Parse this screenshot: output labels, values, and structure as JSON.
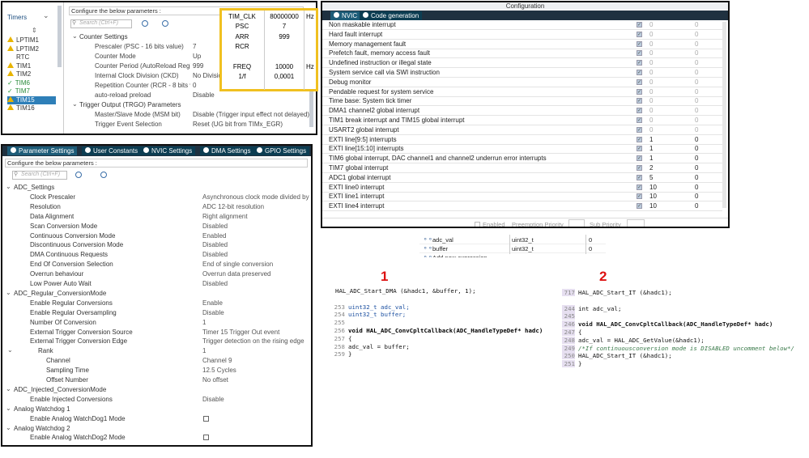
{
  "timers": {
    "header": "Timers",
    "items": [
      {
        "label": "LPTIM1",
        "status": "warn"
      },
      {
        "label": "LPTIM2",
        "status": "warn"
      },
      {
        "label": "RTC",
        "status": "none"
      },
      {
        "label": "TIM1",
        "status": "warn"
      },
      {
        "label": "TIM2",
        "status": "warn"
      },
      {
        "label": "TIM6",
        "status": "ok"
      },
      {
        "label": "TIM7",
        "status": "ok"
      },
      {
        "label": "TIM15",
        "status": "selected"
      },
      {
        "label": "TIM16",
        "status": "warn"
      }
    ]
  },
  "tim_params": {
    "configure_label": "Configure the below parameters :",
    "search_placeholder": "Search (Ctrl+F)",
    "rows": [
      {
        "label": "Counter Settings",
        "value": "",
        "group": true
      },
      {
        "label": "Prescaler (PSC - 16 bits value)",
        "value": "7"
      },
      {
        "label": "Counter Mode",
        "value": "Up"
      },
      {
        "label": "Counter Period (AutoReload Regist...",
        "value": "999"
      },
      {
        "label": "Internal Clock Division (CKD)",
        "value": "No Division"
      },
      {
        "label": "Repetition Counter (RCR - 8 bits val...",
        "value": "0"
      },
      {
        "label": "auto-reload preload",
        "value": "Disable"
      },
      {
        "label": "Trigger Output (TRGO) Parameters",
        "value": "",
        "group": true
      },
      {
        "label": "Master/Slave Mode (MSM bit)",
        "value": "Disable (Trigger input effect not delayed)"
      },
      {
        "label": "Trigger Event Selection",
        "value": "Reset (UG bit from TIMx_EGR)"
      }
    ]
  },
  "clock_calc": {
    "rows": [
      {
        "name": "TIM_CLK",
        "value": "80000000",
        "unit": "Hz"
      },
      {
        "name": "PSC",
        "value": "7",
        "unit": ""
      },
      {
        "name": "ARR",
        "value": "999",
        "unit": ""
      },
      {
        "name": "RCR",
        "value": "",
        "unit": ""
      },
      {
        "name": "",
        "value": "",
        "unit": ""
      },
      {
        "name": "FREQ",
        "value": "10000",
        "unit": "Hz"
      },
      {
        "name": "1/f",
        "value": "0,0001",
        "unit": ""
      }
    ]
  },
  "config": {
    "title": "Configuration",
    "tabs": [
      "NVIC",
      "Code generation"
    ],
    "interrupts": [
      {
        "name": "Non maskable interrupt",
        "prio": "0",
        "sub": "0"
      },
      {
        "name": "Hard fault interrupt",
        "prio": "0",
        "sub": "0"
      },
      {
        "name": "Memory management fault",
        "prio": "0",
        "sub": "0"
      },
      {
        "name": "Prefetch fault, memory access fault",
        "prio": "0",
        "sub": "0"
      },
      {
        "name": "Undefined instruction or illegal state",
        "prio": "0",
        "sub": "0"
      },
      {
        "name": "System service call via SWI instruction",
        "prio": "0",
        "sub": "0"
      },
      {
        "name": "Debug monitor",
        "prio": "0",
        "sub": "0"
      },
      {
        "name": "Pendable request for system service",
        "prio": "0",
        "sub": "0"
      },
      {
        "name": "Time base: System tick timer",
        "prio": "0",
        "sub": "0"
      },
      {
        "name": "DMA1 channel2 global interrupt",
        "prio": "0",
        "sub": "0"
      },
      {
        "name": "TIM1 break interrupt and TIM15 global interrupt",
        "prio": "0",
        "sub": "0"
      },
      {
        "name": "USART2 global interrupt",
        "prio": "0",
        "sub": "0"
      },
      {
        "name": "EXTI line[9:5] interrupts",
        "prio": "1",
        "sub": "0"
      },
      {
        "name": "EXTI line[15:10] interrupts",
        "prio": "1",
        "sub": "0"
      },
      {
        "name": "TIM6 global interrupt, DAC channel1 and channel2 underrun error interrupts",
        "prio": "1",
        "sub": "0"
      },
      {
        "name": "TIM7 global interrupt",
        "prio": "2",
        "sub": "0"
      },
      {
        "name": "ADC1 global interrupt",
        "prio": "5",
        "sub": "0"
      },
      {
        "name": "EXTI line0 interrupt",
        "prio": "10",
        "sub": "0"
      },
      {
        "name": "EXTI line1 interrupt",
        "prio": "10",
        "sub": "0"
      },
      {
        "name": "EXTI line4 interrupt",
        "prio": "10",
        "sub": "0"
      }
    ],
    "footer": {
      "enabled": "Enabled",
      "preemption": "Preemption Priority",
      "sub": "Sub Priority"
    }
  },
  "adc": {
    "tabs": [
      "Parameter Settings",
      "User Constants",
      "NVIC Settings",
      "DMA Settings",
      "GPIO Settings"
    ],
    "configure_label": "Configure the below parameters :",
    "search_placeholder": "Search (Ctrl+F)",
    "rows": [
      {
        "label": "ADC_Settings",
        "value": "",
        "level": 0
      },
      {
        "label": "Clock Prescaler",
        "value": "Asynchronous clock mode divided by 1",
        "level": 1
      },
      {
        "label": "Resolution",
        "value": "ADC 12-bit resolution",
        "level": 1
      },
      {
        "label": "Data Alignment",
        "value": "Right alignment",
        "level": 1
      },
      {
        "label": "Scan Conversion Mode",
        "value": "Disabled",
        "level": 1
      },
      {
        "label": "Continuous Conversion Mode",
        "value": "Enabled",
        "level": 1
      },
      {
        "label": "Discontinuous Conversion Mode",
        "value": "Disabled",
        "level": 1
      },
      {
        "label": "DMA Continuous Requests",
        "value": "Disabled",
        "level": 1
      },
      {
        "label": "End Of Conversion Selection",
        "value": "End of single conversion",
        "level": 1
      },
      {
        "label": "Overrun behaviour",
        "value": "Overrun data preserved",
        "level": 1
      },
      {
        "label": "Low Power Auto Wait",
        "value": "Disabled",
        "level": 1
      },
      {
        "label": "ADC_Regular_ConversionMode",
        "value": "",
        "level": 0
      },
      {
        "label": "Enable Regular Conversions",
        "value": "Enable",
        "level": 1
      },
      {
        "label": "Enable Regular Oversampling",
        "value": "Disable",
        "level": 1
      },
      {
        "label": "Number Of Conversion",
        "value": "1",
        "level": 1
      },
      {
        "label": "External Trigger Conversion Source",
        "value": "Timer 15 Trigger Out event",
        "level": 1
      },
      {
        "label": "External Trigger Conversion Edge",
        "value": "Trigger detection on the rising edge",
        "level": 1
      },
      {
        "label": "Rank",
        "value": "1",
        "level": 2
      },
      {
        "label": "Channel",
        "value": "Channel 9",
        "level": 3
      },
      {
        "label": "Sampling Time",
        "value": "12.5 Cycles",
        "level": 3
      },
      {
        "label": "Offset Number",
        "value": "No offset",
        "level": 3
      },
      {
        "label": "ADC_Injected_ConversionMode",
        "value": "",
        "level": 0
      },
      {
        "label": "Enable Injected Conversions",
        "value": "Disable",
        "level": 1
      },
      {
        "label": "Analog Watchdog 1",
        "value": "",
        "level": 0
      },
      {
        "label": "Enable Analog WatchDog1 Mode",
        "value": "",
        "level": 1
      },
      {
        "label": "Analog Watchdog 2",
        "value": "",
        "level": 0
      },
      {
        "label": "Enable Analog WatchDog2 Mode",
        "value": "",
        "level": 1
      }
    ]
  },
  "variables": [
    {
      "name": "adc_val",
      "type": "uint32_t",
      "value": "0"
    },
    {
      "name": "buffer",
      "type": "uint32_t",
      "value": "0"
    },
    {
      "name": "Add new expression",
      "type": "",
      "value": ""
    }
  ],
  "code1": {
    "label": "1",
    "lines": [
      {
        "num": "",
        "text": "HAL_ADC_Start_DMA (&hadc1, &buffer, 1);"
      },
      {
        "num": "",
        "text": ""
      },
      {
        "num": "253",
        "text": "uint32_t adc_val;"
      },
      {
        "num": "254",
        "text": "uint32_t buffer;"
      },
      {
        "num": "255",
        "text": ""
      },
      {
        "num": "256",
        "text": "void HAL_ADC_ConvCpltCallback(ADC_HandleTypeDef* hadc)"
      },
      {
        "num": "257",
        "text": "{"
      },
      {
        "num": "258",
        "text": "    adc_val = buffer;"
      },
      {
        "num": "259",
        "text": "}"
      }
    ]
  },
  "code2": {
    "label": "2",
    "lines": [
      {
        "num": "717",
        "text": "HAL_ADC_Start_IT (&hadc1);"
      },
      {
        "num": "",
        "text": ""
      },
      {
        "num": "244",
        "text": "int adc_val;"
      },
      {
        "num": "245",
        "text": ""
      },
      {
        "num": "246",
        "text": "void HAL_ADC_ConvCpltCallback(ADC_HandleTypeDef* hadc)"
      },
      {
        "num": "247",
        "text": "{"
      },
      {
        "num": "248",
        "text": "  adc_val = HAL_ADC_GetValue(&hadc1);"
      },
      {
        "num": "249",
        "text": "  /*If continuousconversion mode is DISABLED uncomment below*/"
      },
      {
        "num": "250",
        "text": "  HAL_ADC_Start_IT (&hadc1);"
      },
      {
        "num": "251",
        "text": "}"
      }
    ]
  }
}
